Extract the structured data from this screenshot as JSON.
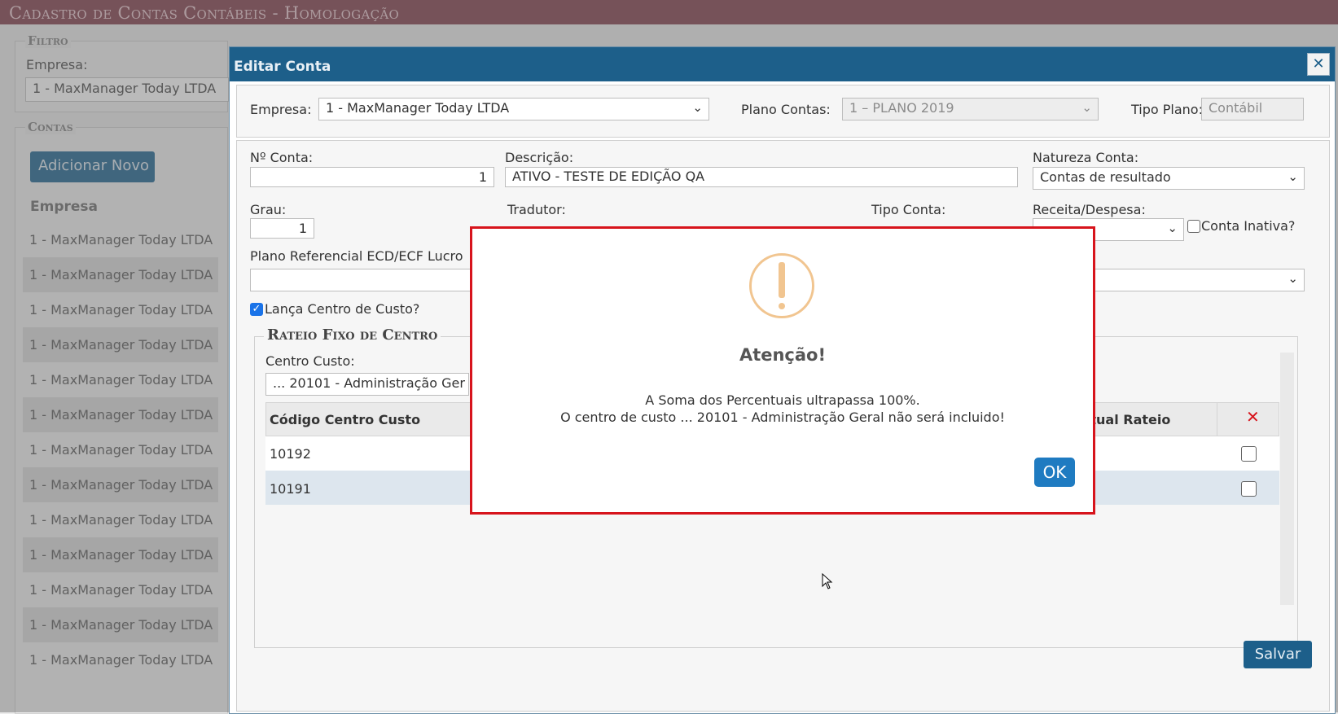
{
  "app": {
    "title": "Cadastro de Contas Contábeis  - Homologação"
  },
  "filter": {
    "legend": "Filtro",
    "company_label": "Empresa:",
    "company_value": "1 - MaxManager Today LTDA"
  },
  "accounts": {
    "legend": "Contas",
    "add_button": "Adicionar Novo",
    "column_header": "Empresa",
    "rows": [
      "1 - MaxManager Today LTDA",
      "1 - MaxManager Today LTDA",
      "1 - MaxManager Today LTDA",
      "1 - MaxManager Today LTDA",
      "1 - MaxManager Today LTDA",
      "1 - MaxManager Today LTDA",
      "1 - MaxManager Today LTDA",
      "1 - MaxManager Today LTDA",
      "1 - MaxManager Today LTDA",
      "1 - MaxManager Today LTDA",
      "1 - MaxManager Today LTDA",
      "1 - MaxManager Today LTDA",
      "1 - MaxManager Today LTDA"
    ]
  },
  "dialog": {
    "title": "Editar Conta",
    "close_icon": "✕",
    "empresa_label": "Empresa:",
    "empresa_value": "1 - MaxManager Today LTDA",
    "plano_label": "Plano Contas:",
    "plano_value": "1 – PLANO 2019",
    "tipo_plano_label": "Tipo Plano:",
    "tipo_plano_value": "Contábil",
    "numero_label": "Nº Conta:",
    "numero_value": "1",
    "descricao_label": "Descrição:",
    "descricao_value": "ATIVO - TESTE DE EDIÇÃO QA",
    "natureza_label": "Natureza Conta:",
    "natureza_value": "Contas de resultado",
    "grau_label": "Grau:",
    "grau_value": "1",
    "tradutor_label": "Tradutor:",
    "tipo_conta_label": "Tipo Conta:",
    "receita_label": "Receita/Despesa:",
    "inativa_label": "Conta Inativa?",
    "plano_ref_label": "Plano Referencial ECD/ECF Lucro",
    "lanca_cc_label": "Lança Centro de Custo?",
    "rateio_legend": "Rateio Fixo de Centro",
    "centro_custo_label": "Centro Custo:",
    "centro_custo_value": "... 20101 - Administração Ger",
    "grid": {
      "col_code": "Código Centro Custo",
      "col_percent": "ntual Rateio",
      "delete_icon": "✕",
      "rows": [
        "10192",
        "10191"
      ]
    },
    "save_button": "Salvar"
  },
  "alert": {
    "icon": "!",
    "title": "Atenção!",
    "line1": "A Soma dos Percentuais ultrapassa 100%.",
    "line2": "O centro de custo ... 20101 - Administração Geral não será incluido!",
    "ok_button": "OK"
  },
  "colors": {
    "header": "#8a4d58",
    "dialog_head": "#1d5f8a",
    "alert_border": "#d7141c",
    "ok_button": "#1f7bc1",
    "warning_icon": "#f1c590"
  }
}
